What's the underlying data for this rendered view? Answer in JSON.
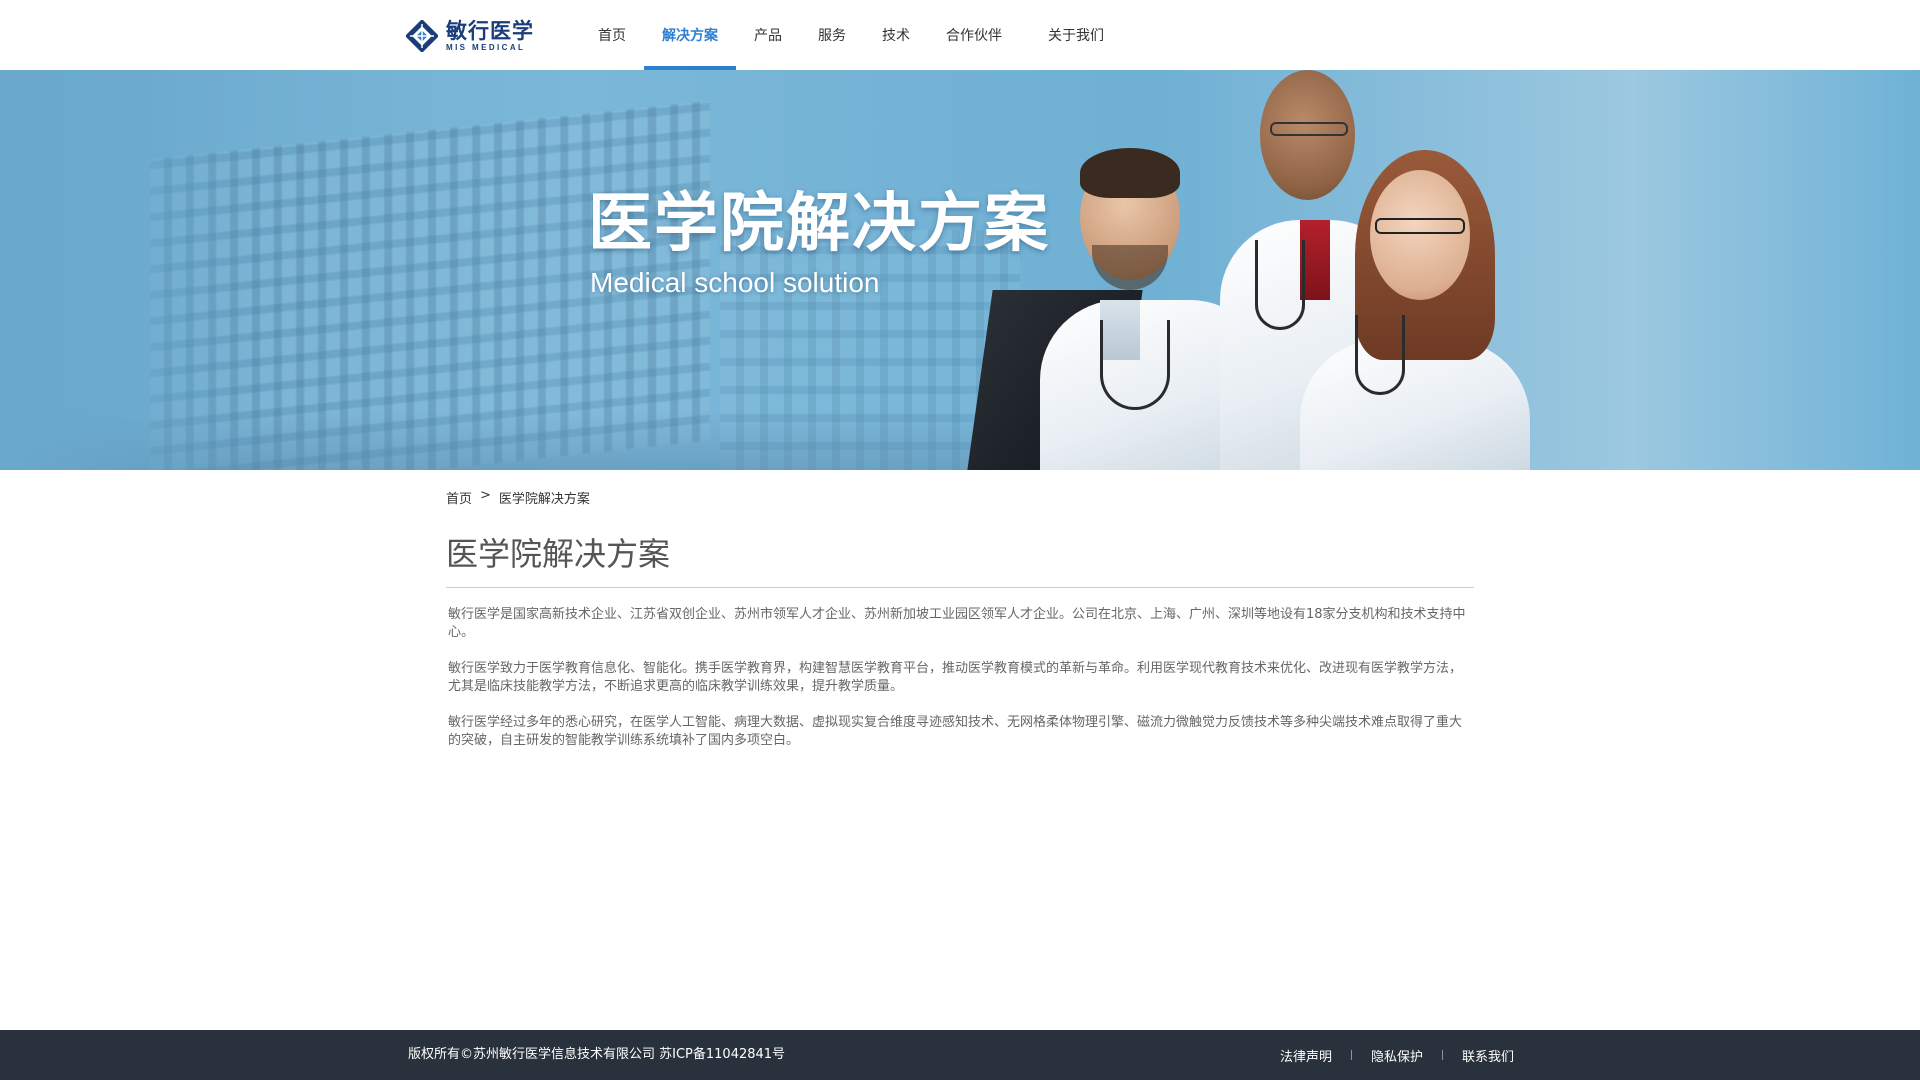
{
  "header": {
    "logo": {
      "cn": "敏行医学",
      "en": "MIS MEDICAL"
    },
    "nav": [
      {
        "label": "首页",
        "active": false
      },
      {
        "label": "解决方案",
        "active": true
      },
      {
        "label": "产品",
        "active": false
      },
      {
        "label": "服务",
        "active": false
      },
      {
        "label": "技术",
        "active": false
      },
      {
        "label": "合作伙伴",
        "active": false
      },
      {
        "label": "关于我们",
        "active": false
      }
    ],
    "accent_color": "#2f7fd1"
  },
  "banner": {
    "title": "医学院解决方案",
    "subtitle": "Medical school solution"
  },
  "breadcrumb": {
    "home": "首页",
    "separator": ">",
    "current": "医学院解决方案"
  },
  "main": {
    "title": "医学院解决方案",
    "paragraphs": [
      "敏行医学是国家高新技术企业、江苏省双创企业、苏州市领军人才企业、苏州新加坡工业园区领军人才企业。公司在北京、上海、广州、深圳等地设有18家分支机构和技术支持中心。",
      "敏行医学致力于医学教育信息化、智能化。携手医学教育界，构建智慧医学教育平台，推动医学教育模式的革新与革命。利用医学现代教育技术来优化、改进现有医学教学方法，尤其是临床技能教学方法，不断追求更高的临床教学训练效果，提升教学质量。",
      "敏行医学经过多年的悉心研究，在医学人工智能、病理大数据、虚拟现实复合维度寻迹感知技术、无网格柔体物理引擎、磁流力微触觉力反馈技术等多种尖端技术难点取得了重大的突破，自主研发的智能教学训练系统填补了国内多项空白。"
    ]
  },
  "footer": {
    "copyright": "版权所有©苏州敏行医学信息技术有限公司  苏ICP备11042841号",
    "links": [
      "法律声明",
      "隐私保护",
      "联系我们"
    ],
    "background": "#29313c"
  }
}
